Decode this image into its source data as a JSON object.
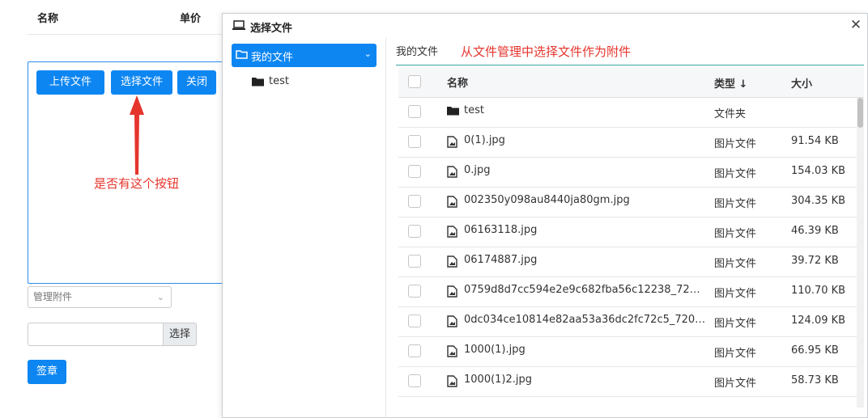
{
  "background": {
    "header": {
      "col_name": "名称",
      "col_unit": "单价"
    },
    "buttons": {
      "upload": "上传文件",
      "choose": "选择文件",
      "close": "关闭"
    },
    "annotation": "是否有这个按钮",
    "manage_select": "管理附件",
    "pick_button": "选择",
    "sign_button": "签章"
  },
  "dialog": {
    "title": "选择文件",
    "tree": {
      "root": "我的文件",
      "child": "test"
    },
    "breadcrumb": "我的文件",
    "annotation": "从文件管理中选择文件作为附件",
    "columns": {
      "name": "名称",
      "type": "类型",
      "sort": "↓",
      "size": "大小"
    },
    "rows": [
      {
        "name": "test",
        "type": "文件夹",
        "size": "",
        "kind": "folder"
      },
      {
        "name": "0(1).jpg",
        "type": "图片文件",
        "size": "91.54 KB",
        "kind": "image"
      },
      {
        "name": "0.jpg",
        "type": "图片文件",
        "size": "154.03 KB",
        "kind": "image"
      },
      {
        "name": "002350y098au8440ja80gm.jpg",
        "type": "图片文件",
        "size": "304.35 KB",
        "kind": "image"
      },
      {
        "name": "06163118.jpg",
        "type": "图片文件",
        "size": "46.39 KB",
        "kind": "image"
      },
      {
        "name": "06174887.jpg",
        "type": "图片文件",
        "size": "39.72 KB",
        "kind": "image"
      },
      {
        "name": "0759d8d7cc594e2e9c682fba56c12238_72…",
        "type": "图片文件",
        "size": "110.70 KB",
        "kind": "image"
      },
      {
        "name": "0dc034ce10814e82aa53a36dc2fc72c5_720…",
        "type": "图片文件",
        "size": "124.09 KB",
        "kind": "image"
      },
      {
        "name": "1000(1).jpg",
        "type": "图片文件",
        "size": "66.95 KB",
        "kind": "image"
      },
      {
        "name": "1000(1)2.jpg",
        "type": "图片文件",
        "size": "58.73 KB",
        "kind": "image"
      }
    ]
  },
  "colors": {
    "primary": "#0d86f2",
    "annotation": "#e5352d",
    "divider": "#3aa6a0"
  }
}
